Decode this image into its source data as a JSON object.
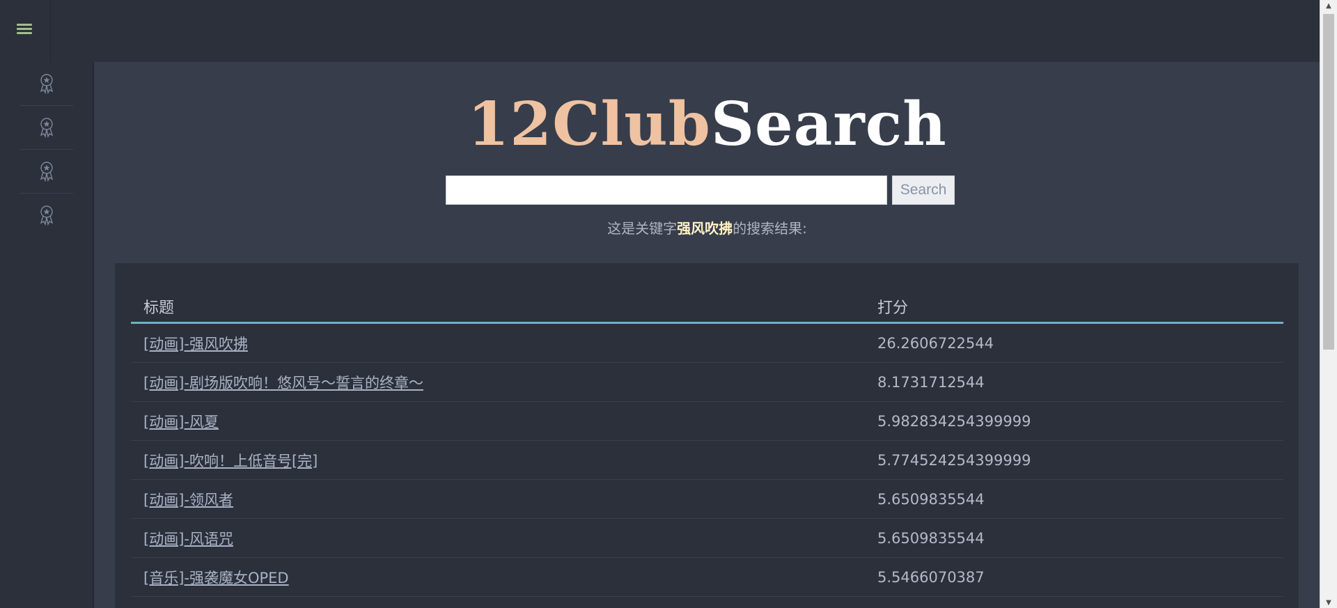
{
  "header": {
    "menu_icon": "hamburger-menu-icon",
    "accent": "#a3be8c"
  },
  "sidebar": {
    "items": [
      {
        "icon": "award-icon"
      },
      {
        "icon": "award-icon"
      },
      {
        "icon": "award-icon"
      },
      {
        "icon": "award-icon"
      }
    ]
  },
  "logo": {
    "part1": "12Club",
    "part2": "Search",
    "part1_color": "#efc2a1",
    "part2_color": "#ffffff"
  },
  "search": {
    "value": "",
    "placeholder": "",
    "button_label": "Search"
  },
  "caption": {
    "prefix": "这是关键字",
    "keyword": "强风吹拂",
    "suffix": "的搜索结果:"
  },
  "results": {
    "headers": {
      "title": "标题",
      "score": "打分"
    },
    "rows": [
      {
        "title": "[动画]-强风吹拂",
        "score": "26.2606722544"
      },
      {
        "title": "[动画]-剧场版吹响！悠风号～誓言的终章～",
        "score": "8.1731712544"
      },
      {
        "title": "[动画]-风夏",
        "score": "5.982834254399999"
      },
      {
        "title": "[动画]-吹响！上低音号[完]",
        "score": "5.774524254399999"
      },
      {
        "title": "[动画]-领风者",
        "score": "5.6509835544"
      },
      {
        "title": "[动画]-风语咒",
        "score": "5.6509835544"
      },
      {
        "title": "[音乐]-强袭魔女OPED",
        "score": "5.5466070387"
      }
    ]
  }
}
